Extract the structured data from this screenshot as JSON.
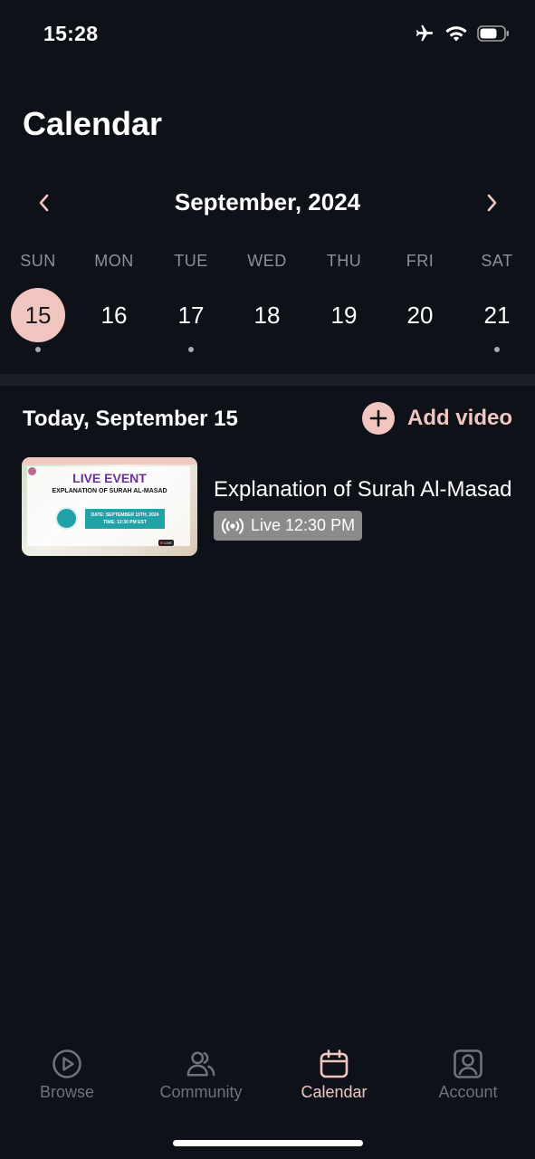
{
  "status_bar": {
    "time": "15:28"
  },
  "header": {
    "title": "Calendar"
  },
  "calendar": {
    "month_label": "September, 2024",
    "days": [
      {
        "name": "SUN",
        "date": "15",
        "selected": true,
        "has_event": true
      },
      {
        "name": "MON",
        "date": "16",
        "selected": false,
        "has_event": false
      },
      {
        "name": "TUE",
        "date": "17",
        "selected": false,
        "has_event": true
      },
      {
        "name": "WED",
        "date": "18",
        "selected": false,
        "has_event": false
      },
      {
        "name": "THU",
        "date": "19",
        "selected": false,
        "has_event": false
      },
      {
        "name": "FRI",
        "date": "20",
        "selected": false,
        "has_event": false
      },
      {
        "name": "SAT",
        "date": "21",
        "selected": false,
        "has_event": true
      }
    ]
  },
  "schedule": {
    "date_label": "Today, September 15",
    "add_video_label": "Add video",
    "items": [
      {
        "title": "Explanation of Surah Al-Masad",
        "live_label": "Live 12:30 PM",
        "thumbnail": {
          "headline": "LIVE EVENT",
          "subheadline": "EXPLANATION OF SURAH AL-MASAD",
          "date_line": "DATE: SEPTEMBER 15TH, 2024",
          "time_line": "TIME: 12:30 PM EST",
          "live_tag": "LIVE"
        }
      }
    ]
  },
  "tab_bar": {
    "tabs": [
      {
        "label": "Browse",
        "icon": "play-circle-icon",
        "active": false
      },
      {
        "label": "Community",
        "icon": "users-icon",
        "active": false
      },
      {
        "label": "Calendar",
        "icon": "calendar-icon",
        "active": true
      },
      {
        "label": "Account",
        "icon": "account-icon",
        "active": false
      }
    ]
  },
  "colors": {
    "background": "#0e1117",
    "accent": "#f1c6c1",
    "muted": "#6f727a"
  }
}
